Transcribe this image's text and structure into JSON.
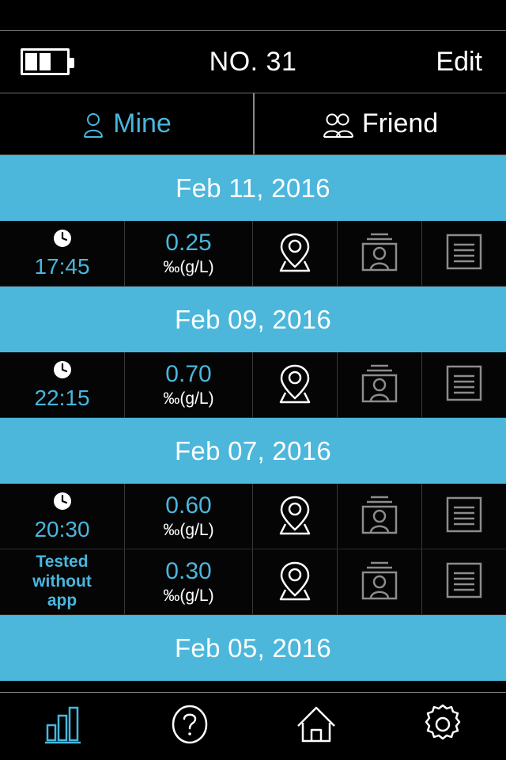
{
  "header": {
    "battery_icon": "battery-icon",
    "battery_segments_filled": 2,
    "battery_segments_total": 3,
    "title": "NO. 31",
    "edit_label": "Edit"
  },
  "tabs": [
    {
      "label": "Mine",
      "icon": "single-person-icon",
      "active": true
    },
    {
      "label": "Friend",
      "icon": "two-person-icon",
      "active": false
    }
  ],
  "colors": {
    "accent": "#4cb7db",
    "accent_text": "#49b6dd",
    "background": "#000000",
    "text": "#ffffff",
    "icon_dim": "#8c8c8c"
  },
  "unit_label": "‰(g/L)",
  "groups": [
    {
      "date": "Feb 11, 2016",
      "rows": [
        {
          "time": "17:45",
          "no_app": false,
          "value": "0.25",
          "unit": "‰(g/L)",
          "icons": [
            "location-pin-icon",
            "photo-card-icon",
            "note-icon"
          ]
        }
      ]
    },
    {
      "date": "Feb 09, 2016",
      "rows": [
        {
          "time": "22:15",
          "no_app": false,
          "value": "0.70",
          "unit": "‰(g/L)",
          "icons": [
            "location-pin-icon",
            "photo-card-icon",
            "note-icon"
          ]
        }
      ]
    },
    {
      "date": "Feb 07, 2016",
      "rows": [
        {
          "time": "20:30",
          "no_app": false,
          "value": "0.60",
          "unit": "‰(g/L)",
          "icons": [
            "location-pin-icon",
            "photo-card-icon",
            "note-icon"
          ]
        },
        {
          "time": "Tested without app",
          "no_app": true,
          "value": "0.30",
          "unit": "‰(g/L)",
          "icons": [
            "location-pin-icon",
            "photo-card-icon",
            "note-icon"
          ]
        }
      ]
    },
    {
      "date": "Feb 05, 2016",
      "rows": []
    }
  ],
  "bottom_nav": [
    {
      "icon": "bar-chart-icon",
      "active": true
    },
    {
      "icon": "help-circle-icon",
      "active": false
    },
    {
      "icon": "home-icon",
      "active": false
    },
    {
      "icon": "gear-icon",
      "active": false
    }
  ]
}
